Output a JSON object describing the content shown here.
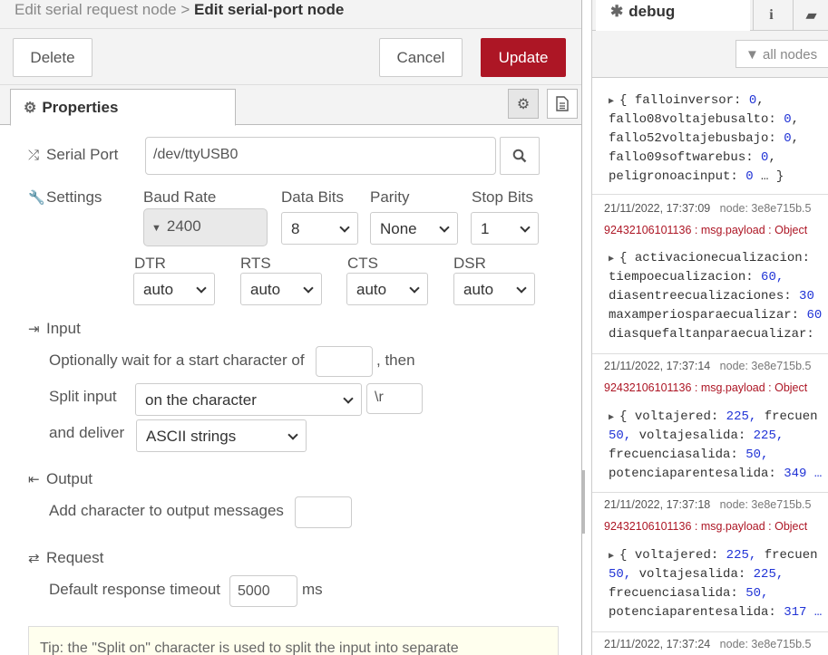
{
  "editor": {
    "breadcrumb_parent": "Edit serial request node",
    "breadcrumb_sep": ">",
    "breadcrumb_current": "Edit serial-port node",
    "delete_label": "Delete",
    "cancel_label": "Cancel",
    "update_label": "Update",
    "properties_tab": "Properties",
    "serial_port_label": "Serial Port",
    "serial_port_value": "/dev/ttyUSB0",
    "settings_label": "Settings",
    "baud_rate_label": "Baud Rate",
    "baud_rate_value": "2400",
    "data_bits_label": "Data Bits",
    "data_bits_value": "8",
    "parity_label": "Parity",
    "parity_value": "None",
    "stop_bits_label": "Stop Bits",
    "stop_bits_value": "1",
    "dtr_label": "DTR",
    "dtr_value": "auto",
    "rts_label": "RTS",
    "rts_value": "auto",
    "cts_label": "CTS",
    "cts_value": "auto",
    "dsr_label": "DSR",
    "dsr_value": "auto",
    "input_section": "Input",
    "wait_start_label": "Optionally wait for a start character of",
    "wait_start_value": "",
    "then_label": ", then",
    "split_input_label": "Split input",
    "split_mode_value": "on the character",
    "split_char_value": "\\r",
    "deliver_label": "and deliver",
    "deliver_value": "ASCII strings",
    "output_section": "Output",
    "add_char_label": "Add character to output messages",
    "add_char_value": "",
    "request_section": "Request",
    "timeout_label": "Default response timeout",
    "timeout_value": "5000",
    "timeout_unit": "ms",
    "tip_text": "Tip: the \"Split on\" character is used to split the input into separate"
  },
  "sidebar": {
    "debug_tab": "debug",
    "filter_label": "all nodes",
    "messages": [
      {
        "lines": [
          [
            [
              "{ ",
              "k"
            ],
            [
              "falloinversor",
              "k"
            ],
            [
              ": ",
              "k"
            ],
            [
              "0",
              "n"
            ],
            [
              ",",
              "k"
            ]
          ],
          [
            [
              "fallo08voltajebusalto",
              "k"
            ],
            [
              ": ",
              "k"
            ],
            [
              "0",
              "n"
            ],
            [
              ",",
              "k"
            ]
          ],
          [
            [
              "fallo52voltajebusbajo",
              "k"
            ],
            [
              ": ",
              "k"
            ],
            [
              "0",
              "n"
            ],
            [
              ",",
              "k"
            ]
          ],
          [
            [
              "fallo09softwarebus",
              "k"
            ],
            [
              ": ",
              "k"
            ],
            [
              "0",
              "n"
            ],
            [
              ",",
              "k"
            ]
          ],
          [
            [
              "peligronoacinput",
              "k"
            ],
            [
              ": ",
              "k"
            ],
            [
              "0",
              "n"
            ],
            [
              " … }",
              "k"
            ]
          ]
        ]
      }
    ],
    "entries": [
      {
        "time": "21/11/2022, 17:37:09",
        "node": "node: 3e8e715b.5",
        "topic": "92432106101136 : msg.payload : Object",
        "l1": "activacionecualizacion:",
        "l2k": "tiempoecualizacion:",
        "l2v": "60,",
        "l3k": "diasentreecualizaciones:",
        "l3v": "30",
        "l4k": "maxamperiosparaecualizar:",
        "l4v": "60",
        "l5k": "diasquefaltanparaecualizar:",
        "l5v": ""
      },
      {
        "time": "21/11/2022, 17:37:14",
        "node": "node: 3e8e715b.5",
        "topic": "92432106101136 : msg.payload : Object",
        "l1": "voltajered:",
        "l1v": "225,",
        "l1b": "frecuen",
        "l2k": "50,",
        "l2b": "voltajesalida:",
        "l2v": "225,",
        "l3k": "frecuenciasalida:",
        "l3v": "50,",
        "l4k": "potenciaparentesalida:",
        "l4v": "349 …"
      },
      {
        "time": "21/11/2022, 17:37:18",
        "node": "node: 3e8e715b.5",
        "topic": "92432106101136 : msg.payload : Object",
        "l1": "voltajered:",
        "l1v": "225,",
        "l1b": "frecuen",
        "l2k": "50,",
        "l2b": "voltajesalida:",
        "l2v": "225,",
        "l3k": "frecuenciasalida:",
        "l3v": "50,",
        "l4k": "potenciaparentesalida:",
        "l4v": "317 …"
      },
      {
        "time": "21/11/2022, 17:37:24",
        "node": "node: 3e8e715b.5"
      }
    ]
  }
}
